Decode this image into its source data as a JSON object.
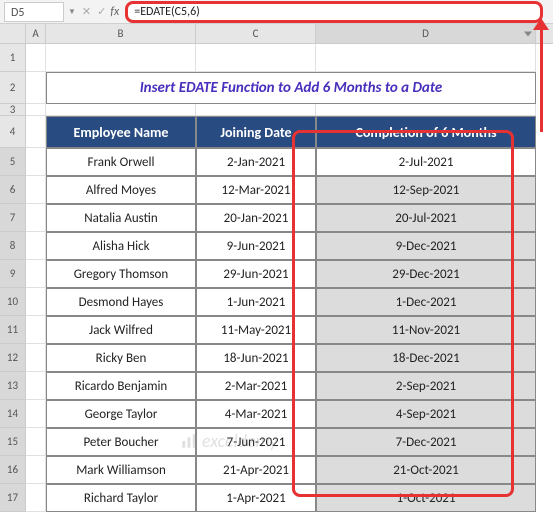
{
  "formula_bar": {
    "cell_ref": "D5",
    "fx_label": "fx",
    "formula": "=EDATE(C5,6)"
  },
  "columns": {
    "A": "A",
    "B": "B",
    "C": "C",
    "D": "D"
  },
  "row_numbers": [
    "1",
    "2",
    "3",
    "4",
    "5",
    "6",
    "7",
    "8",
    "9",
    "10",
    "11",
    "12",
    "13",
    "14",
    "15",
    "16",
    "17"
  ],
  "title": "Insert EDATE Function to Add 6 Months to a Date",
  "headers": {
    "name": "Employee Name",
    "joining": "Joining Date",
    "completion": "Completion of 6 Months"
  },
  "rows": [
    {
      "name": "Frank Orwell",
      "joining": "2-Jan-2021",
      "completion": "2-Jul-2021"
    },
    {
      "name": "Alfred Moyes",
      "joining": "12-Mar-2021",
      "completion": "12-Sep-2021"
    },
    {
      "name": "Natalia Austin",
      "joining": "20-Jan-2021",
      "completion": "20-Jul-2021"
    },
    {
      "name": "Alisha Hick",
      "joining": "9-Jun-2021",
      "completion": "9-Dec-2021"
    },
    {
      "name": "Gregory Thomson",
      "joining": "29-Jun-2021",
      "completion": "29-Dec-2021"
    },
    {
      "name": "Desmond Hayes",
      "joining": "1-Jun-2021",
      "completion": "1-Dec-2021"
    },
    {
      "name": "Jack Wilfred",
      "joining": "11-May-2021",
      "completion": "11-Nov-2021"
    },
    {
      "name": "Ricky Ben",
      "joining": "18-Jun-2021",
      "completion": "18-Dec-2021"
    },
    {
      "name": "Ricardo Benjamin",
      "joining": "2-Mar-2021",
      "completion": "2-Sep-2021"
    },
    {
      "name": "George Taylor",
      "joining": "4-Mar-2021",
      "completion": "4-Sep-2021"
    },
    {
      "name": "Peter Boucher",
      "joining": "7-Jun-2021",
      "completion": "7-Dec-2021"
    },
    {
      "name": "Mark Williamson",
      "joining": "21-Apr-2021",
      "completion": "21-Oct-2021"
    },
    {
      "name": "Richard Taylor",
      "joining": "1-Apr-2021",
      "completion": "1-Oct-2021"
    }
  ],
  "watermark": "exceldemy"
}
